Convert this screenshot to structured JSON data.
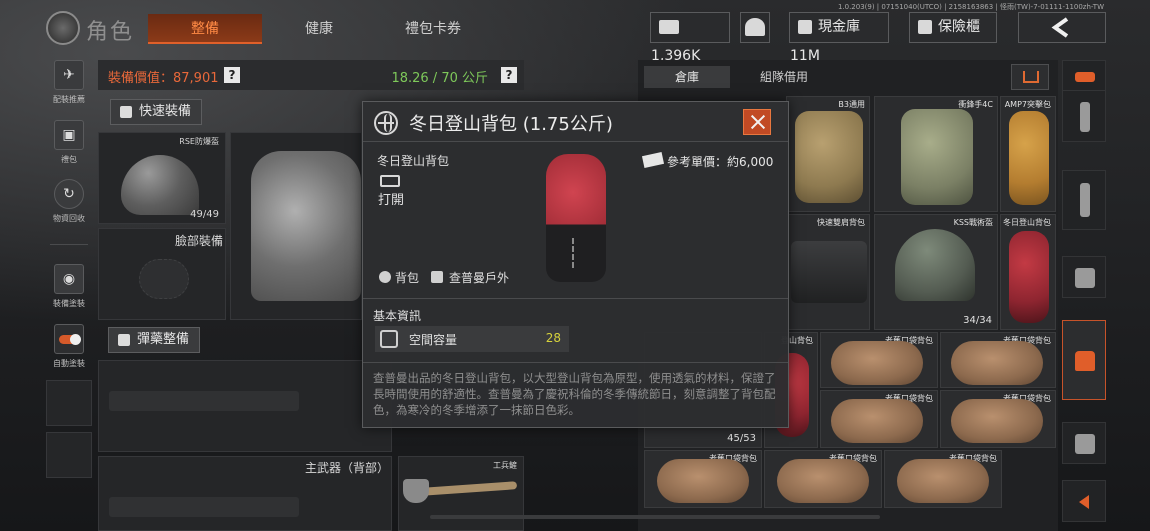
{
  "header": {
    "title": "角色",
    "tabs": [
      {
        "label": "整備",
        "active": true
      },
      {
        "label": "健康",
        "active": false
      },
      {
        "label": "禮包卡券",
        "active": false
      }
    ],
    "version": "1.0.203(9) | 07151040(UTCO) | 2158163863 | 怪雨(TW)-7-01111-1100zh-TW",
    "cash": "1,396K",
    "vault_label": "現金庫 11M",
    "safe_label": "保險櫃",
    "accent": "#e0602a"
  },
  "sidebar": {
    "items": [
      {
        "label": "配裝推薦",
        "icon": "loadout-icon"
      },
      {
        "label": "禮包",
        "icon": "gift-icon"
      },
      {
        "label": "物資回收",
        "icon": "recycle-icon"
      },
      {
        "label": "裝備塗裝",
        "icon": "paint-icon"
      },
      {
        "label": "自動塗裝",
        "icon": "toggle-icon"
      }
    ]
  },
  "equipment": {
    "value_label": "裝備價值：87,901",
    "weight": "18.26 / 70 公斤",
    "quick_equip": "快速裝備",
    "ammo_setup": "彈藥整備",
    "helmet": {
      "name": "RSE防爆盔",
      "durability": "49/49"
    },
    "face_slot": "臉部裝備",
    "primary_back": "主武器（背部）",
    "melee": "工兵鏟"
  },
  "storage": {
    "tabs": [
      "倉庫",
      "組隊借用"
    ],
    "items": [
      {
        "label": "B3通用",
        "count": ""
      },
      {
        "label": "衝鋒手4C",
        "count": ""
      },
      {
        "label": "AMP7突擊包",
        "count": ""
      },
      {
        "label": "快速雙肩背包",
        "count": ""
      },
      {
        "label": "KSS戰術盔",
        "count": "34/34"
      },
      {
        "label": "冬日登山背包",
        "count": ""
      },
      {
        "label": "登山背包",
        "count": "45/53"
      },
      {
        "label": "老舊口袋背包",
        "count": ""
      },
      {
        "label": "老舊口袋背包",
        "count": ""
      },
      {
        "label": "老舊口袋背包",
        "count": ""
      },
      {
        "label": "老舊口袋背包",
        "count": ""
      },
      {
        "label": "老舊口袋背包",
        "count": ""
      },
      {
        "label": "老舊口袋背包",
        "count": ""
      },
      {
        "label": "老舊口袋背包",
        "count": ""
      }
    ]
  },
  "popup": {
    "title": "冬日登山背包 (1.75公斤)",
    "item_name": "冬日登山背包",
    "open_label": "打開",
    "price_label": "參考單價：約6,000",
    "tags": [
      "背包",
      "查普曼戶外"
    ],
    "section": "基本資訊",
    "stat_name": "空間容量",
    "stat_value": "28",
    "description": "查普曼出品的冬日登山背包，以大型登山背包為原型，使用透氣的材料，保證了長時間使用的舒適性。查普曼為了慶祝科倫的冬季傳統節日，刻意調整了背包配色，為寒冷的冬季增添了一抹節日色彩。"
  }
}
